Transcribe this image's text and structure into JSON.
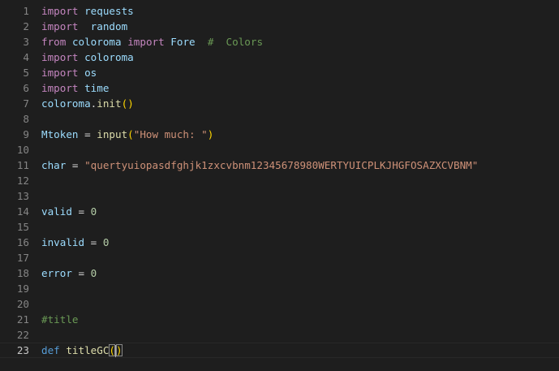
{
  "editor": {
    "peek_text": "\"\"",
    "lines": [
      {
        "num": "1",
        "tokens": [
          {
            "t": "import",
            "c": "kw-ctrl"
          },
          {
            "t": " ",
            "c": "plain"
          },
          {
            "t": "requests",
            "c": "var"
          }
        ]
      },
      {
        "num": "2",
        "tokens": [
          {
            "t": "import",
            "c": "kw-ctrl"
          },
          {
            "t": "  ",
            "c": "plain"
          },
          {
            "t": "random",
            "c": "var"
          }
        ]
      },
      {
        "num": "3",
        "tokens": [
          {
            "t": "from",
            "c": "kw-ctrl"
          },
          {
            "t": " ",
            "c": "plain"
          },
          {
            "t": "coloroma",
            "c": "var"
          },
          {
            "t": " ",
            "c": "plain"
          },
          {
            "t": "import",
            "c": "kw-ctrl"
          },
          {
            "t": " ",
            "c": "plain"
          },
          {
            "t": "Fore",
            "c": "var"
          },
          {
            "t": "  ",
            "c": "plain"
          },
          {
            "t": "#  Colors",
            "c": "cmt"
          }
        ]
      },
      {
        "num": "4",
        "tokens": [
          {
            "t": "import",
            "c": "kw-ctrl"
          },
          {
            "t": " ",
            "c": "plain"
          },
          {
            "t": "coloroma",
            "c": "var"
          }
        ]
      },
      {
        "num": "5",
        "tokens": [
          {
            "t": "import",
            "c": "kw-ctrl"
          },
          {
            "t": " ",
            "c": "plain"
          },
          {
            "t": "os",
            "c": "var"
          }
        ]
      },
      {
        "num": "6",
        "tokens": [
          {
            "t": "import",
            "c": "kw-ctrl"
          },
          {
            "t": " ",
            "c": "plain"
          },
          {
            "t": "time",
            "c": "var"
          }
        ]
      },
      {
        "num": "7",
        "tokens": [
          {
            "t": "coloroma",
            "c": "var"
          },
          {
            "t": ".",
            "c": "plain"
          },
          {
            "t": "init",
            "c": "fn"
          },
          {
            "t": "()",
            "c": "paren"
          }
        ]
      },
      {
        "num": "8",
        "tokens": []
      },
      {
        "num": "9",
        "tokens": [
          {
            "t": "Mtoken",
            "c": "var"
          },
          {
            "t": " = ",
            "c": "plain"
          },
          {
            "t": "input",
            "c": "fn"
          },
          {
            "t": "(",
            "c": "paren"
          },
          {
            "t": "\"How much: \"",
            "c": "str"
          },
          {
            "t": ")",
            "c": "paren"
          }
        ]
      },
      {
        "num": "10",
        "tokens": []
      },
      {
        "num": "11",
        "tokens": [
          {
            "t": "char",
            "c": "var"
          },
          {
            "t": " = ",
            "c": "plain"
          },
          {
            "t": "\"quertyuiopasdfghjk1zxcvbnm12345678980WERTYUICPLKJHGFOSAZXCVBNM\"",
            "c": "str"
          }
        ]
      },
      {
        "num": "12",
        "tokens": []
      },
      {
        "num": "13",
        "tokens": []
      },
      {
        "num": "14",
        "tokens": [
          {
            "t": "valid",
            "c": "var"
          },
          {
            "t": " = ",
            "c": "plain"
          },
          {
            "t": "0",
            "c": "num"
          }
        ]
      },
      {
        "num": "15",
        "tokens": []
      },
      {
        "num": "16",
        "tokens": [
          {
            "t": "invalid",
            "c": "var"
          },
          {
            "t": " = ",
            "c": "plain"
          },
          {
            "t": "0",
            "c": "num"
          }
        ]
      },
      {
        "num": "17",
        "tokens": []
      },
      {
        "num": "18",
        "tokens": [
          {
            "t": "error",
            "c": "var"
          },
          {
            "t": " = ",
            "c": "plain"
          },
          {
            "t": "0",
            "c": "num"
          }
        ]
      },
      {
        "num": "19",
        "tokens": []
      },
      {
        "num": "20",
        "tokens": []
      },
      {
        "num": "21",
        "tokens": [
          {
            "t": "#title",
            "c": "cmt"
          }
        ]
      },
      {
        "num": "22",
        "tokens": []
      },
      {
        "num": "23",
        "current": true,
        "tokens": [
          {
            "t": "def",
            "c": "kw"
          },
          {
            "t": " ",
            "c": "plain"
          },
          {
            "t": "titleGC",
            "c": "fn"
          },
          {
            "t": "(",
            "c": "paren-match"
          },
          {
            "t": "|",
            "c": "cursor"
          },
          {
            "t": ")",
            "c": "paren-match"
          }
        ]
      }
    ]
  },
  "colors": {
    "background": "#1e1e1e",
    "line_number": "#858585",
    "keyword_control": "#c586c0",
    "keyword": "#569cd6",
    "variable": "#9cdcfe",
    "function": "#dcdcaa",
    "string": "#ce9178",
    "number": "#b5cea8",
    "comment": "#6a9955",
    "bracket": "#ffd700"
  }
}
